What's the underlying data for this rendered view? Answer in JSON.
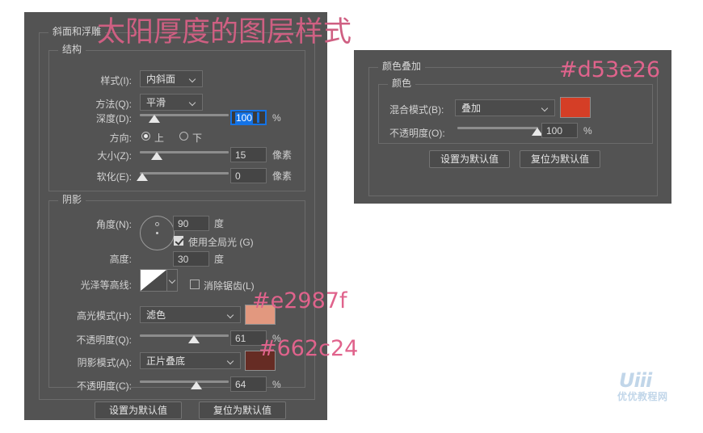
{
  "annotations": {
    "title": "太阳厚度的图层样式",
    "highlight_hex": "#e2987f",
    "shadow_hex": "#662c24",
    "overlay_hex": "#d53e26",
    "pink": "#e0638c"
  },
  "watermark": {
    "mark": "Uiii",
    "text": "优优教程网"
  },
  "bevel_panel": {
    "title": "斜面和浮雕",
    "structure": {
      "title": "结构",
      "style": {
        "label": "样式(I):",
        "value": "内斜面"
      },
      "technique": {
        "label": "方法(Q):",
        "value": "平滑"
      },
      "depth": {
        "label": "深度(D):",
        "value": "100",
        "unit": "%",
        "slider_pct": 15
      },
      "direction": {
        "label": "方向:",
        "up": "上",
        "down": "下",
        "selected": "上"
      },
      "size": {
        "label": "大小(Z):",
        "value": "15",
        "unit": "像素",
        "slider_pct": 18
      },
      "soften": {
        "label": "软化(E):",
        "value": "0",
        "unit": "像素",
        "slider_pct": 2
      }
    },
    "shading": {
      "title": "阴影",
      "angle": {
        "label": "角度(N):",
        "value": "90",
        "unit": "度"
      },
      "use_global_light": {
        "label": "使用全局光 (G)",
        "checked": true
      },
      "altitude": {
        "label": "高度:",
        "value": "30",
        "unit": "度"
      },
      "gloss_contour": {
        "label": "光泽等高线:"
      },
      "anti_alias": {
        "label": "消除锯齿(L)",
        "checked": false
      },
      "highlight_mode": {
        "label": "高光模式(H):",
        "value": "滤色",
        "color": "#e2987f"
      },
      "highlight_opacity": {
        "label": "不透明度(Q):",
        "value": "61",
        "unit": "%",
        "slider_pct": 61
      },
      "shadow_mode": {
        "label": "阴影模式(A):",
        "value": "正片叠底",
        "color": "#662c24"
      },
      "shadow_opacity": {
        "label": "不透明度(C):",
        "value": "64",
        "unit": "%",
        "slider_pct": 64
      }
    },
    "buttons": {
      "set_default": "设置为默认值",
      "reset_default": "复位为默认值"
    }
  },
  "color_overlay_panel": {
    "title": "颜色叠加",
    "color_group": {
      "title": "颜色",
      "blend_mode": {
        "label": "混合模式(B):",
        "value": "叠加",
        "color": "#d53e26"
      },
      "opacity": {
        "label": "不透明度(O):",
        "value": "100",
        "unit": "%",
        "slider_pct": 100
      }
    },
    "buttons": {
      "set_default": "设置为默认值",
      "reset_default": "复位为默认值"
    }
  }
}
